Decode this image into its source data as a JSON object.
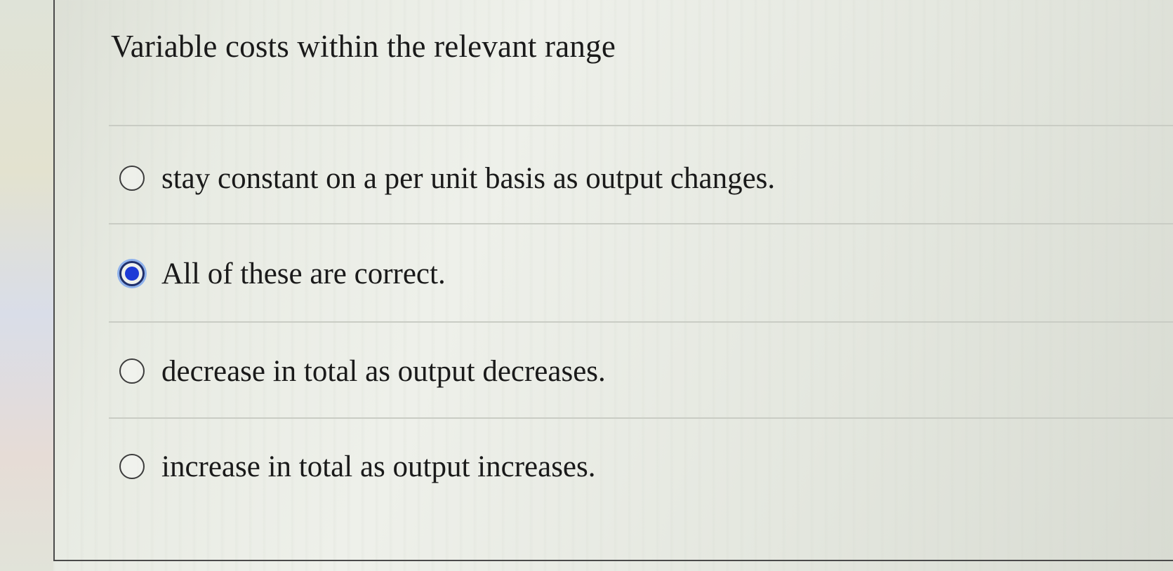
{
  "question": {
    "text": "Variable costs within the relevant range"
  },
  "options": [
    {
      "label": "stay constant on a per unit basis as output changes.",
      "selected": false
    },
    {
      "label": "All of these are correct.",
      "selected": true
    },
    {
      "label": "decrease in total as output decreases.",
      "selected": false
    },
    {
      "label": "increase in total as output increases.",
      "selected": false
    }
  ],
  "colors": {
    "selected_fill": "#1d3ad6",
    "selected_ring": "#8fb2ec",
    "text": "#1a1a1a"
  }
}
